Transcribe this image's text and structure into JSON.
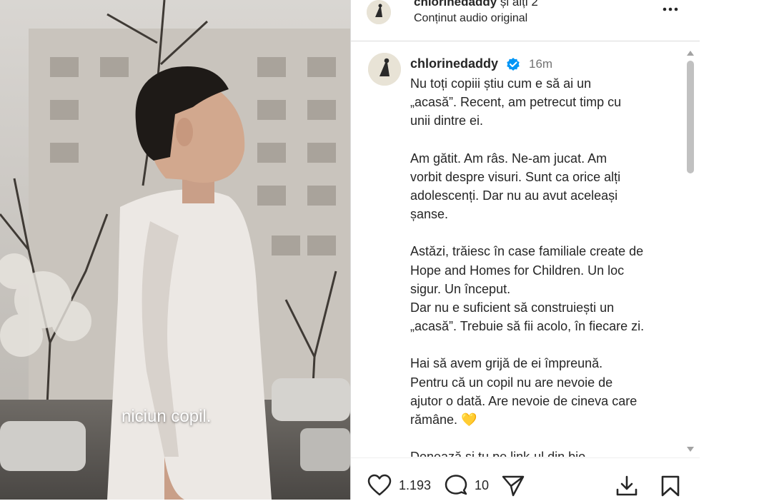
{
  "header": {
    "username": "chlorinedaddy",
    "others": " și alți 2",
    "audio": "Conținut audio original"
  },
  "video": {
    "subtitle": "niciun copil."
  },
  "caption": {
    "username": "chlorinedaddy",
    "time": "16m",
    "paragraphs": [
      [
        "Nu toți copiii știu cum e să ai un",
        "„acasă”. Recent, am petrecut timp cu",
        "unii dintre ei."
      ],
      [
        "Am gătit. Am râs. Ne-am jucat. Am",
        "vorbit despre visuri. Sunt ca orice alți",
        "adolescenți. Dar nu au avut aceleași",
        "șanse."
      ],
      [
        "Astăzi, trăiesc în case familiale create de",
        "Hope and Homes for Children. Un loc",
        "sigur. Un început."
      ],
      [
        "Dar nu e suficient să construiești un",
        "„acasă”. Trebuie să fii acolo, în fiecare zi."
      ],
      [
        "Hai să avem grijă de ei împreună.",
        "Pentru că un copil nu are nevoie de",
        "ajutor o dată. Are nevoie de cineva care",
        "rămâne. 💛"
      ],
      [
        "Donează și tu pe link-ul din bio."
      ]
    ]
  },
  "actions": {
    "likes": "1.193",
    "comments": "10"
  },
  "icons": {
    "more": "more-options-icon",
    "verified": "verified-badge-icon",
    "like": "heart-icon",
    "comment": "comment-icon",
    "share": "send-icon",
    "download": "download-icon",
    "save": "bookmark-icon"
  },
  "colors": {
    "verified": "#0095f6",
    "text": "#262626",
    "secondary": "#737373"
  }
}
